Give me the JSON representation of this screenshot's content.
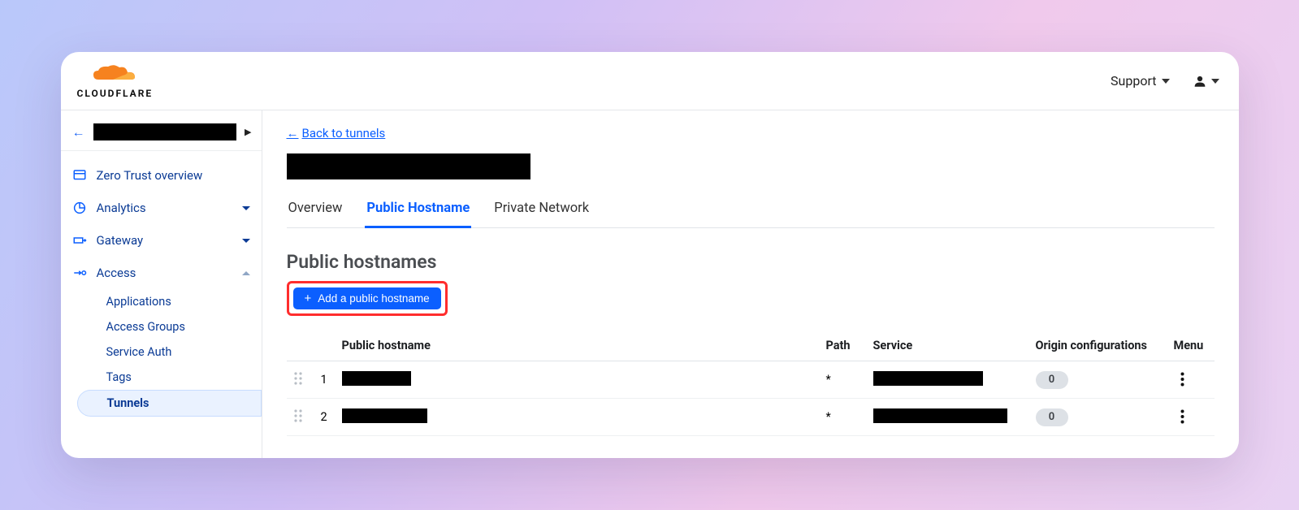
{
  "brand": {
    "name": "CLOUDFLARE"
  },
  "header": {
    "support_label": "Support"
  },
  "sidebar": {
    "items": [
      {
        "label": "Zero Trust overview",
        "icon": "dashboard-icon"
      },
      {
        "label": "Analytics",
        "icon": "analytics-icon"
      },
      {
        "label": "Gateway",
        "icon": "gateway-icon"
      },
      {
        "label": "Access",
        "icon": "access-icon"
      }
    ],
    "access_sub": [
      {
        "label": "Applications"
      },
      {
        "label": "Access Groups"
      },
      {
        "label": "Service Auth"
      },
      {
        "label": "Tags"
      },
      {
        "label": "Tunnels",
        "active": true
      }
    ]
  },
  "main": {
    "back_link": "Back to tunnels",
    "tabs": [
      {
        "label": "Overview"
      },
      {
        "label": "Public Hostname",
        "active": true
      },
      {
        "label": "Private Network"
      }
    ],
    "section_title": "Public hostnames",
    "add_button": "Add a public hostname",
    "table": {
      "headers": {
        "hostname": "Public hostname",
        "path": "Path",
        "service": "Service",
        "origin": "Origin configurations",
        "menu": "Menu"
      },
      "rows": [
        {
          "index": "1",
          "path": "*",
          "origin_count": "0",
          "host_w": 85,
          "svc_w": 135
        },
        {
          "index": "2",
          "path": "*",
          "origin_count": "0",
          "host_w": 105,
          "svc_w": 165
        }
      ]
    }
  }
}
